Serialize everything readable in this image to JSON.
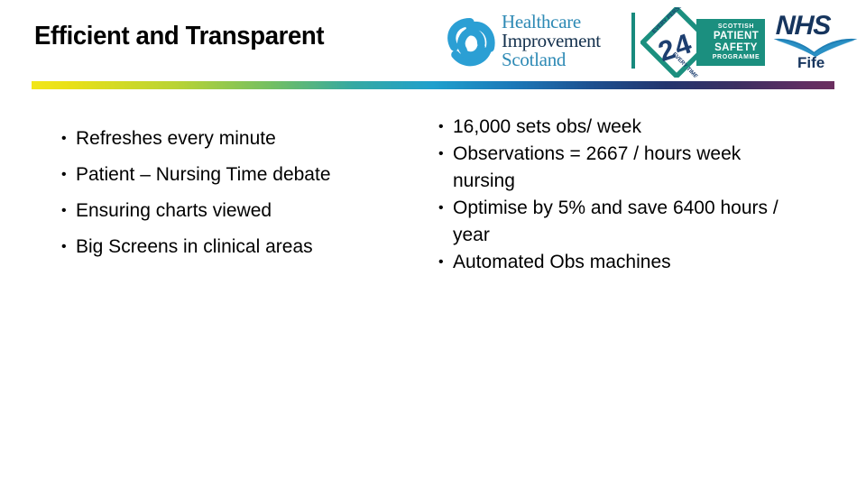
{
  "slide": {
    "title": "Efficient and Transparent"
  },
  "logos": {
    "healthcare_improvement_scotland": {
      "icon": "trefoil-knot-icon",
      "line1": "Healthcare",
      "line2": "Improvement",
      "line3": "Scotland",
      "teal": "#2e8ab5",
      "navy": "#13304d"
    },
    "divider_color": "#178a7d",
    "spsp": {
      "diamond_top_text": "EVERY PERSON",
      "diamond_bottom_text": "EVERY TIME",
      "diamond_numeral": "24",
      "panel_line1": "SCOTTISH",
      "panel_line2": "PATIENT",
      "panel_line3": "SAFETY",
      "panel_line4": "PROGRAMME",
      "panel_color": "#1b8f7f",
      "numeral_color": "#1d3f70"
    },
    "nhs_fife": {
      "nhs": "NHS",
      "board": "Fife",
      "navy": "#16355e",
      "swoosh_color": "#1f7fb5"
    }
  },
  "rule": {
    "gradient_stops": [
      "#f2e61a",
      "#b9d334",
      "#72bf63",
      "#35a9a2",
      "#1fa0cd",
      "#1b78b8",
      "#1d4f8f",
      "#23356e",
      "#5f2f63",
      "#6b2f5f"
    ]
  },
  "content": {
    "bullet_glyph": "•",
    "left_column": [
      "Refreshes every minute",
      "Patient – Nursing Time debate",
      "Ensuring charts viewed",
      "Big Screens in clinical areas"
    ],
    "right_column": [
      "16,000 sets obs/ week",
      "Observations = 2667 / hours week nursing",
      "Optimise by 5% and save 6400 hours / year",
      "Automated Obs machines"
    ]
  }
}
